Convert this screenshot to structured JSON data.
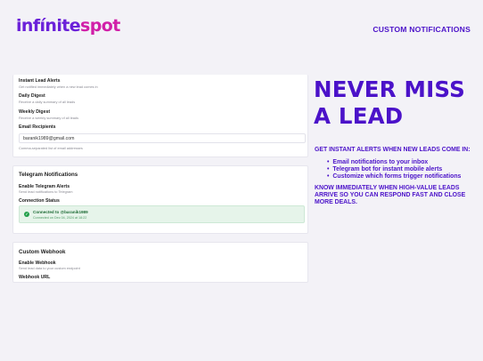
{
  "brand": {
    "logo_part1": "infínite",
    "logo_part2": "spot",
    "nav_link": "CUSTOM NOTIFICATIONS"
  },
  "email_panel": {
    "instant_label": "Instant Lead Alerts",
    "instant_desc": "Get notified immediately when a new lead comes in",
    "daily_label": "Daily Digest",
    "daily_desc": "Receive a daily summary of all leads",
    "weekly_label": "Weekly Digest",
    "weekly_desc": "Receive a weekly summary of all leads",
    "recipients_label": "Email Recipients",
    "recipients_value": "baranik1989@gmail.com",
    "recipients_help": "Comma-separated list of email addresses"
  },
  "telegram_panel": {
    "title": "Telegram Notifications",
    "enable_label": "Enable Telegram Alerts",
    "enable_desc": "Send lead notifications to Telegram",
    "status_label": "Connection Status",
    "status_main": "Connected to @baranik1989",
    "status_sub": "Connected on Dec 04, 2024 at 18:22"
  },
  "webhook_panel": {
    "title": "Custom Webhook",
    "enable_label": "Enable Webhook",
    "enable_desc": "Send lead data to your custom endpoint",
    "url_label": "Webhook URL"
  },
  "marketing": {
    "headline_line1": "NEVER MISS",
    "headline_line2": "A LEAD",
    "intro": "GET INSTANT ALERTS WHEN NEW LEADS COME IN:",
    "bullets": [
      "Email notifications to your inbox",
      "Telegram bot for instant mobile alerts",
      "Customize which forms trigger notifications"
    ],
    "outro_lines": [
      "KNOW IMMEDIATELY WHEN HIGH-VALUE LEADS",
      "ARRIVE SO YOU CAN RESPOND FAST AND CLOSE",
      "MORE DEALS."
    ]
  },
  "colors": {
    "accent": "#4b12c9",
    "brand_magenta": "#d11fa8",
    "success": "#22a04b",
    "background": "#f3f2f7"
  }
}
